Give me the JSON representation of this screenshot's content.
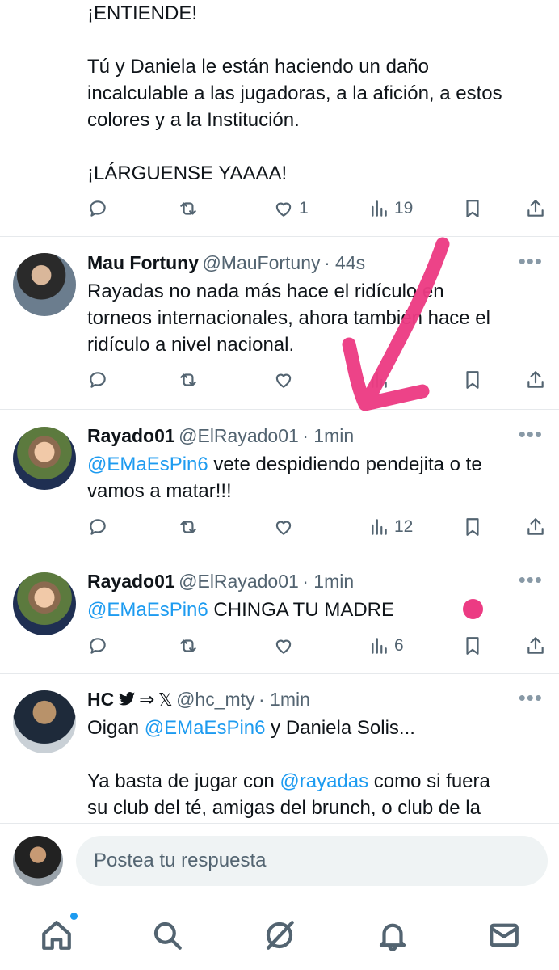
{
  "tweet0": {
    "lines": [
      "¡ENTIENDE!",
      "",
      "Tú y Daniela le están haciendo un daño",
      "incalculable a las jugadoras, a la afición, a estos",
      "colores y a la Institución.",
      "",
      "¡LÁRGUENSE YAAAA!"
    ],
    "likes": "1",
    "views": "19"
  },
  "tweet1": {
    "name": "Mau Fortuny",
    "handle": "@MauFortuny",
    "time": "· 44s",
    "lines": [
      "Rayadas no nada más hace el ridículo en",
      "torneos internacionales, ahora también hace el",
      "ridículo a nivel nacional."
    ]
  },
  "tweet2": {
    "name": "Rayado01",
    "handle": "@ElRayado01",
    "time": "· 1min",
    "mention": "@EMaEsPin6",
    "text1": " vete despidiendo pendejita o te",
    "text2": "vamos a matar!!!",
    "views": "12"
  },
  "tweet3": {
    "name": "Rayado01",
    "handle": "@ElRayado01",
    "time": "· 1min",
    "mention": "@EMaEsPin6",
    "text": " CHINGA TU MADRE",
    "views": "6"
  },
  "tweet4": {
    "name": "HC",
    "name_suffix": "⇒",
    "x_glyph": "𝕏",
    "handle": "@hc_mty",
    "time": "· 1min",
    "line1_a": "Oigan ",
    "line1_mention": "@EMaEsPin6",
    "line1_b": " y Daniela Solis...",
    "line3_a": "Ya basta de jugar con ",
    "line3_mention": "@rayadas",
    "line3_b": " como si fuera",
    "line4": "su club del té, amigas del brunch, o club de la"
  },
  "compose": {
    "placeholder": "Postea tu respuesta"
  },
  "nav": [
    "home-icon",
    "search-icon",
    "grok-icon",
    "notifications-icon",
    "messages-icon"
  ],
  "colors": {
    "accent": "#1d9bf0",
    "annotation": "#ec3b83",
    "text": "#0f1419",
    "muted": "#536471"
  }
}
